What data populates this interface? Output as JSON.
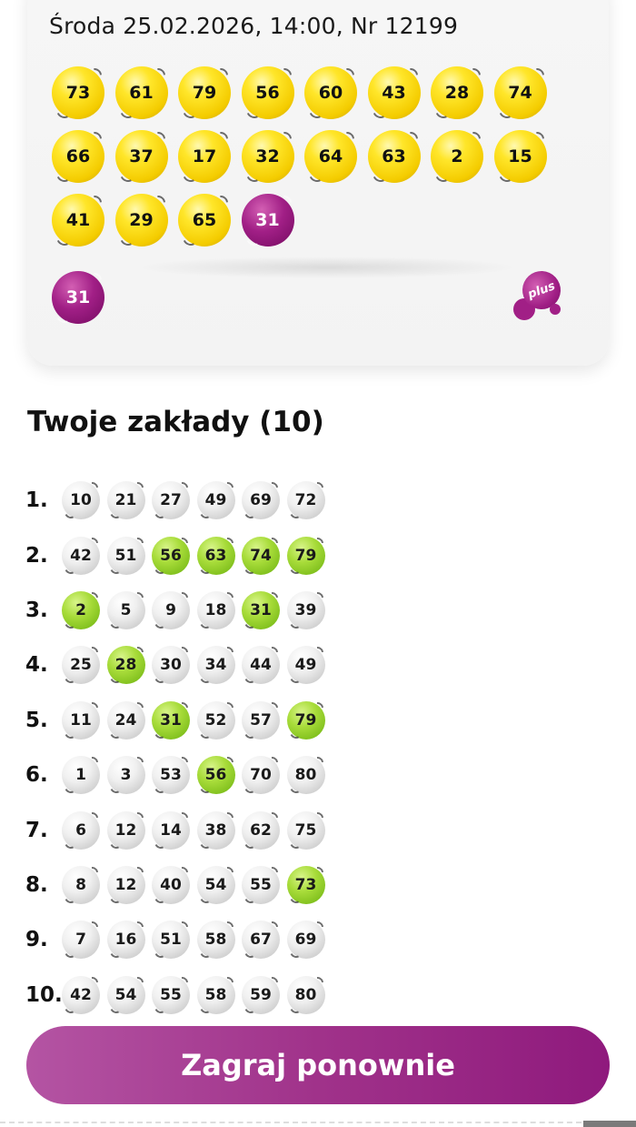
{
  "draw": {
    "header": "Środa 25.02.2026, 14:00, Nr 12199",
    "balls": [
      {
        "num": "73",
        "color": "yellow"
      },
      {
        "num": "61",
        "color": "yellow"
      },
      {
        "num": "79",
        "color": "yellow"
      },
      {
        "num": "56",
        "color": "yellow"
      },
      {
        "num": "60",
        "color": "yellow"
      },
      {
        "num": "43",
        "color": "yellow"
      },
      {
        "num": "28",
        "color": "yellow"
      },
      {
        "num": "74",
        "color": "yellow"
      },
      {
        "num": "66",
        "color": "yellow"
      },
      {
        "num": "37",
        "color": "yellow"
      },
      {
        "num": "17",
        "color": "yellow"
      },
      {
        "num": "32",
        "color": "yellow"
      },
      {
        "num": "64",
        "color": "yellow"
      },
      {
        "num": "63",
        "color": "yellow"
      },
      {
        "num": "2",
        "color": "yellow"
      },
      {
        "num": "15",
        "color": "yellow"
      },
      {
        "num": "41",
        "color": "yellow"
      },
      {
        "num": "29",
        "color": "yellow"
      },
      {
        "num": "65",
        "color": "yellow"
      },
      {
        "num": "31",
        "color": "purple"
      }
    ],
    "plus_ball": "31",
    "plus_logo_text": "plus"
  },
  "bets": {
    "title": "Twoje zakłady (10)",
    "rows": [
      {
        "index": "1.",
        "balls": [
          {
            "n": "10",
            "hit": false
          },
          {
            "n": "21",
            "hit": false
          },
          {
            "n": "27",
            "hit": false
          },
          {
            "n": "49",
            "hit": false
          },
          {
            "n": "69",
            "hit": false
          },
          {
            "n": "72",
            "hit": false
          }
        ]
      },
      {
        "index": "2.",
        "balls": [
          {
            "n": "42",
            "hit": false
          },
          {
            "n": "51",
            "hit": false
          },
          {
            "n": "56",
            "hit": true
          },
          {
            "n": "63",
            "hit": true
          },
          {
            "n": "74",
            "hit": true
          },
          {
            "n": "79",
            "hit": true
          }
        ]
      },
      {
        "index": "3.",
        "balls": [
          {
            "n": "2",
            "hit": true
          },
          {
            "n": "5",
            "hit": false
          },
          {
            "n": "9",
            "hit": false
          },
          {
            "n": "18",
            "hit": false
          },
          {
            "n": "31",
            "hit": true
          },
          {
            "n": "39",
            "hit": false
          }
        ]
      },
      {
        "index": "4.",
        "balls": [
          {
            "n": "25",
            "hit": false
          },
          {
            "n": "28",
            "hit": true
          },
          {
            "n": "30",
            "hit": false
          },
          {
            "n": "34",
            "hit": false
          },
          {
            "n": "44",
            "hit": false
          },
          {
            "n": "49",
            "hit": false
          }
        ]
      },
      {
        "index": "5.",
        "balls": [
          {
            "n": "11",
            "hit": false
          },
          {
            "n": "24",
            "hit": false
          },
          {
            "n": "31",
            "hit": true
          },
          {
            "n": "52",
            "hit": false
          },
          {
            "n": "57",
            "hit": false
          },
          {
            "n": "79",
            "hit": true
          }
        ]
      },
      {
        "index": "6.",
        "balls": [
          {
            "n": "1",
            "hit": false
          },
          {
            "n": "3",
            "hit": false
          },
          {
            "n": "53",
            "hit": false
          },
          {
            "n": "56",
            "hit": true
          },
          {
            "n": "70",
            "hit": false
          },
          {
            "n": "80",
            "hit": false
          }
        ]
      },
      {
        "index": "7.",
        "balls": [
          {
            "n": "6",
            "hit": false
          },
          {
            "n": "12",
            "hit": false
          },
          {
            "n": "14",
            "hit": false
          },
          {
            "n": "38",
            "hit": false
          },
          {
            "n": "62",
            "hit": false
          },
          {
            "n": "75",
            "hit": false
          }
        ]
      },
      {
        "index": "8.",
        "balls": [
          {
            "n": "8",
            "hit": false
          },
          {
            "n": "12",
            "hit": false
          },
          {
            "n": "40",
            "hit": false
          },
          {
            "n": "54",
            "hit": false
          },
          {
            "n": "55",
            "hit": false
          },
          {
            "n": "73",
            "hit": true
          }
        ]
      },
      {
        "index": "9.",
        "balls": [
          {
            "n": "7",
            "hit": false
          },
          {
            "n": "16",
            "hit": false
          },
          {
            "n": "51",
            "hit": false
          },
          {
            "n": "58",
            "hit": false
          },
          {
            "n": "67",
            "hit": false
          },
          {
            "n": "69",
            "hit": false
          }
        ]
      },
      {
        "index": "10.",
        "balls": [
          {
            "n": "42",
            "hit": false
          },
          {
            "n": "54",
            "hit": false
          },
          {
            "n": "55",
            "hit": false
          },
          {
            "n": "58",
            "hit": false
          },
          {
            "n": "59",
            "hit": false
          },
          {
            "n": "80",
            "hit": false
          }
        ]
      }
    ]
  },
  "actions": {
    "play_again_label": "Zagraj ponownie"
  },
  "colors": {
    "yellow_ball": "#f4cc00",
    "purple_ball": "#a11f86",
    "hit_ball": "#a8dc3a",
    "miss_ball": "#e6e6e6",
    "button_start": "#b454a3",
    "button_end": "#8f1a7d"
  }
}
